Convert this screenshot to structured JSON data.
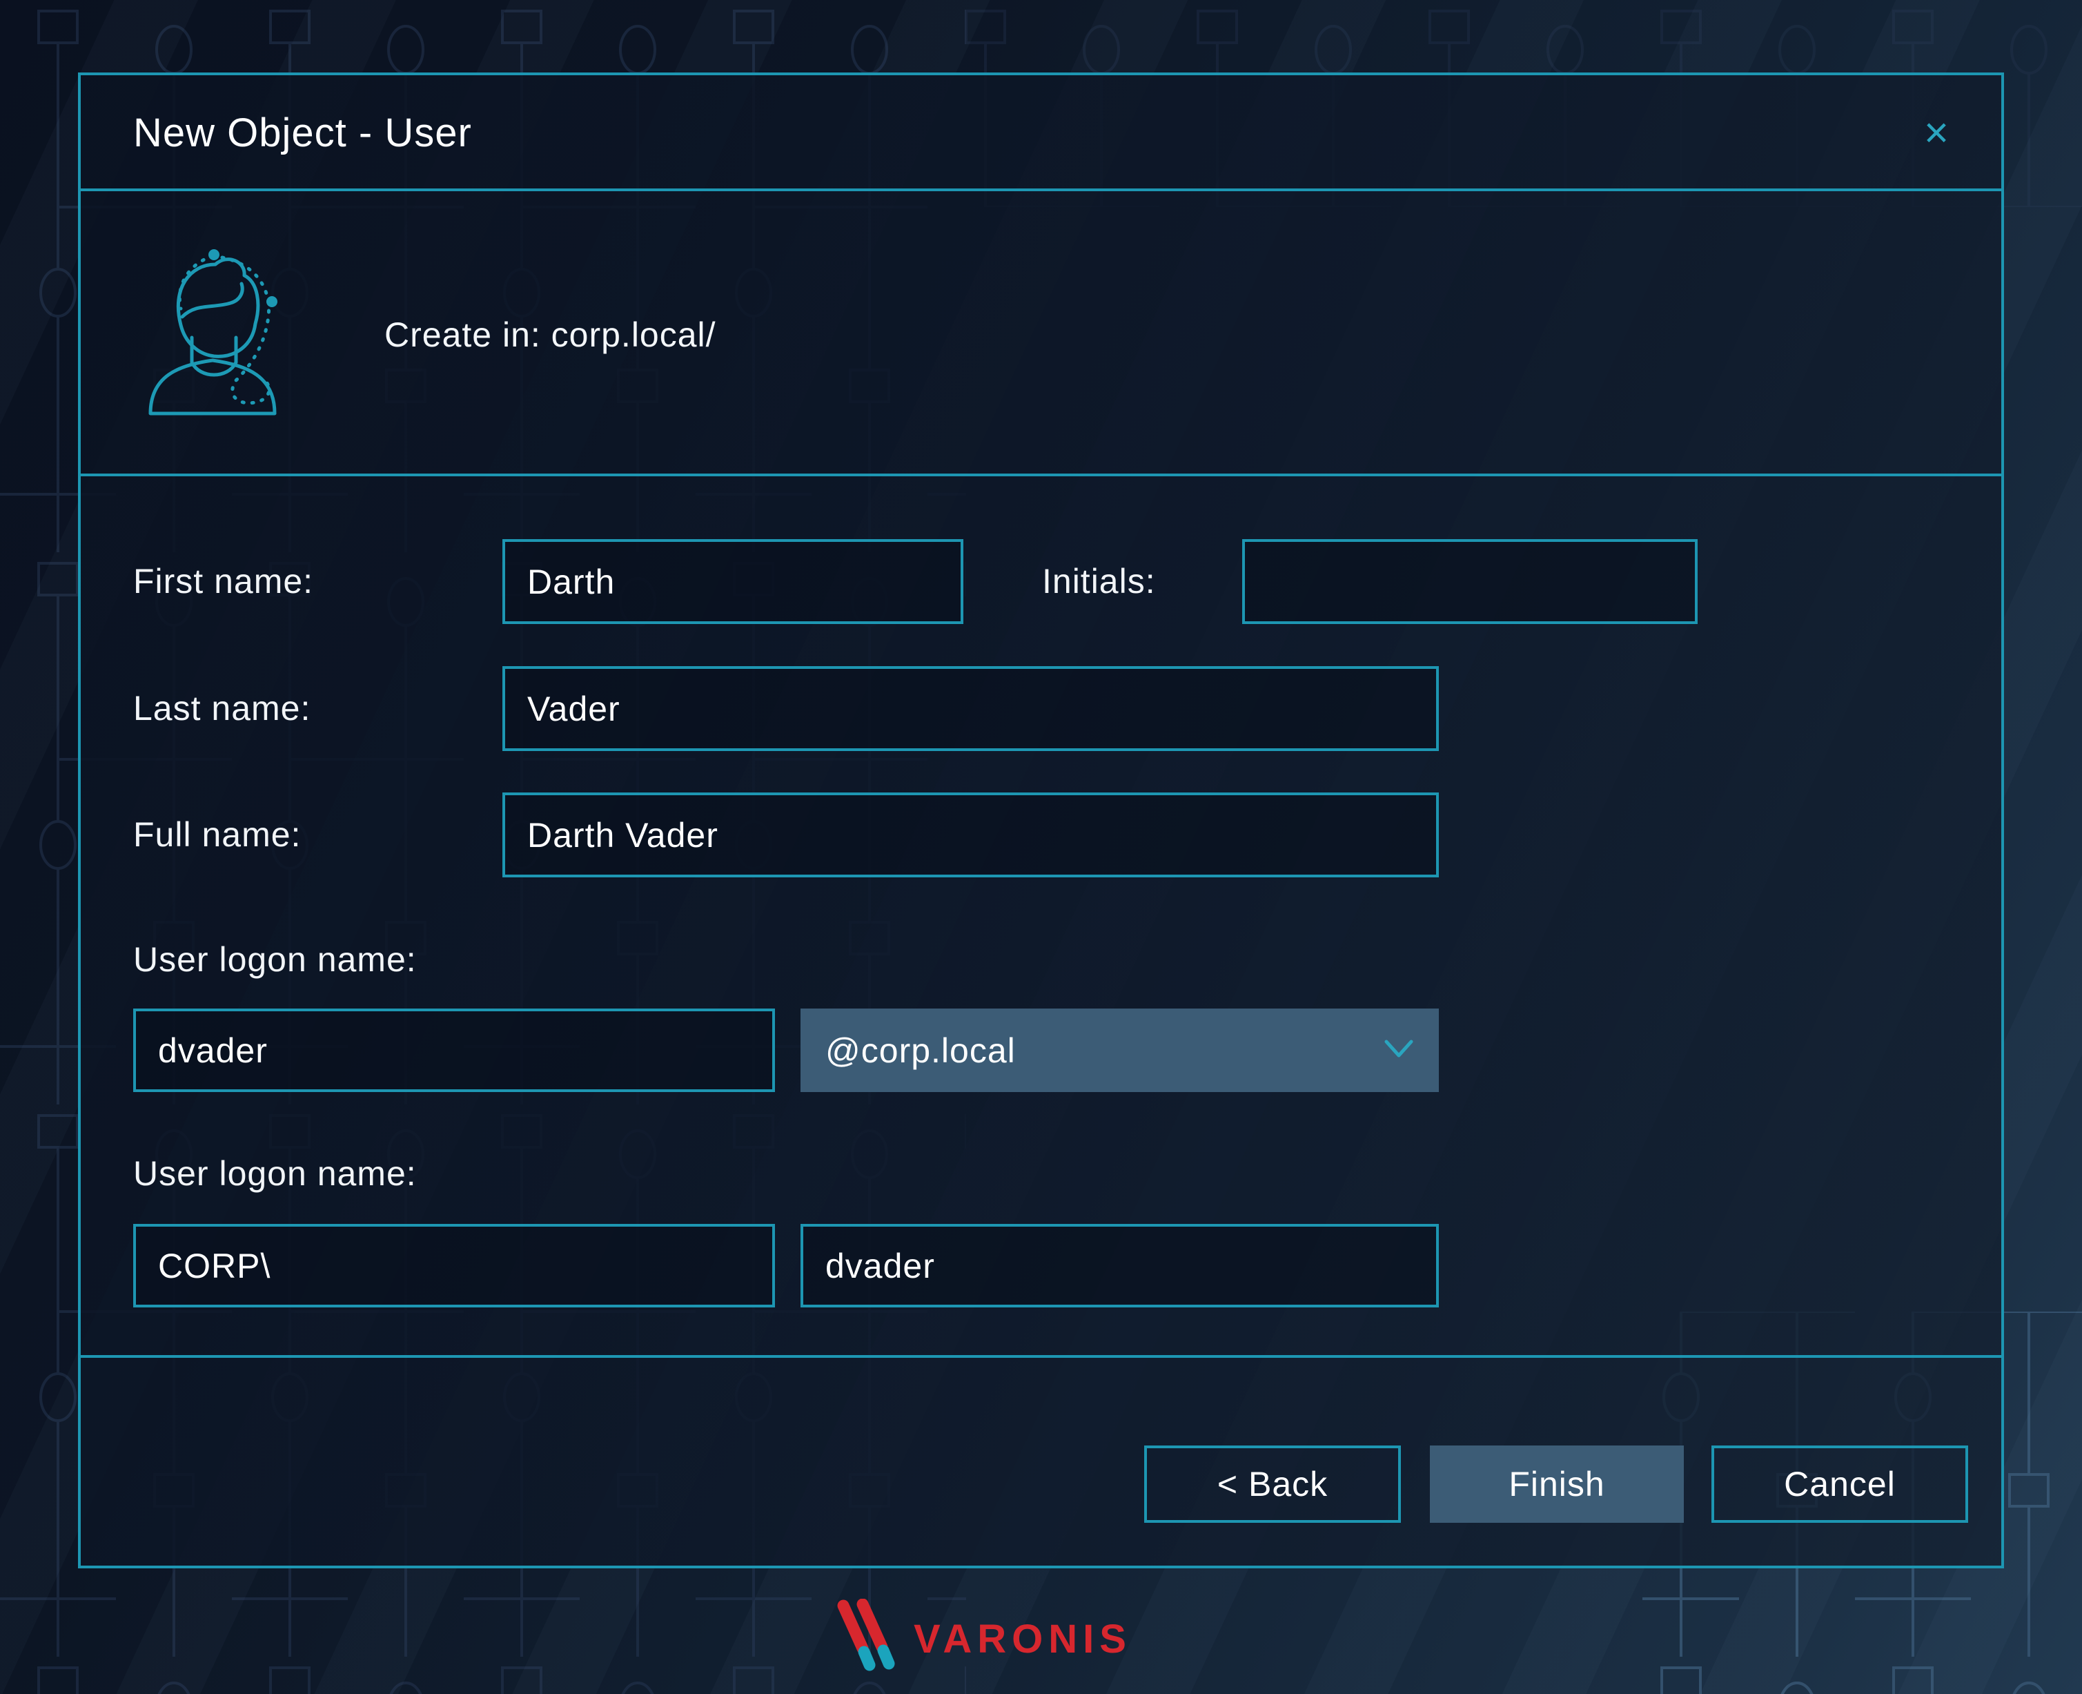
{
  "dialog": {
    "title": "New Object - User",
    "icons": {
      "close": "×",
      "chevron_down": "chevron-down",
      "avatar": "user-person-outline"
    },
    "intro": {
      "create_in": "Create in: corp.local/"
    },
    "form": {
      "first_name": {
        "label": "First name:",
        "value": "Darth"
      },
      "initials": {
        "label": "Initials:",
        "value": ""
      },
      "last_name": {
        "label": "Last name:",
        "value": "Vader"
      },
      "full_name": {
        "label": "Full name:",
        "value": "Darth Vader"
      },
      "logon": {
        "label": "User logon name:",
        "value": "dvader",
        "domain": "@corp.local"
      },
      "logon_pre": {
        "label": "User logon name:",
        "prefix": "CORP\\",
        "value": "dvader"
      }
    },
    "buttons": {
      "back": "< Back",
      "finish": "Finish",
      "cancel": "Cancel"
    }
  },
  "brand": {
    "name": "VARONIS"
  },
  "colors": {
    "accent_teal": "#1d96b2",
    "icon_teal": "#2aa5bf",
    "fill_slate": "#3c5c76",
    "brand_red": "#d7272e",
    "brand_teal": "#1ba4bd"
  }
}
